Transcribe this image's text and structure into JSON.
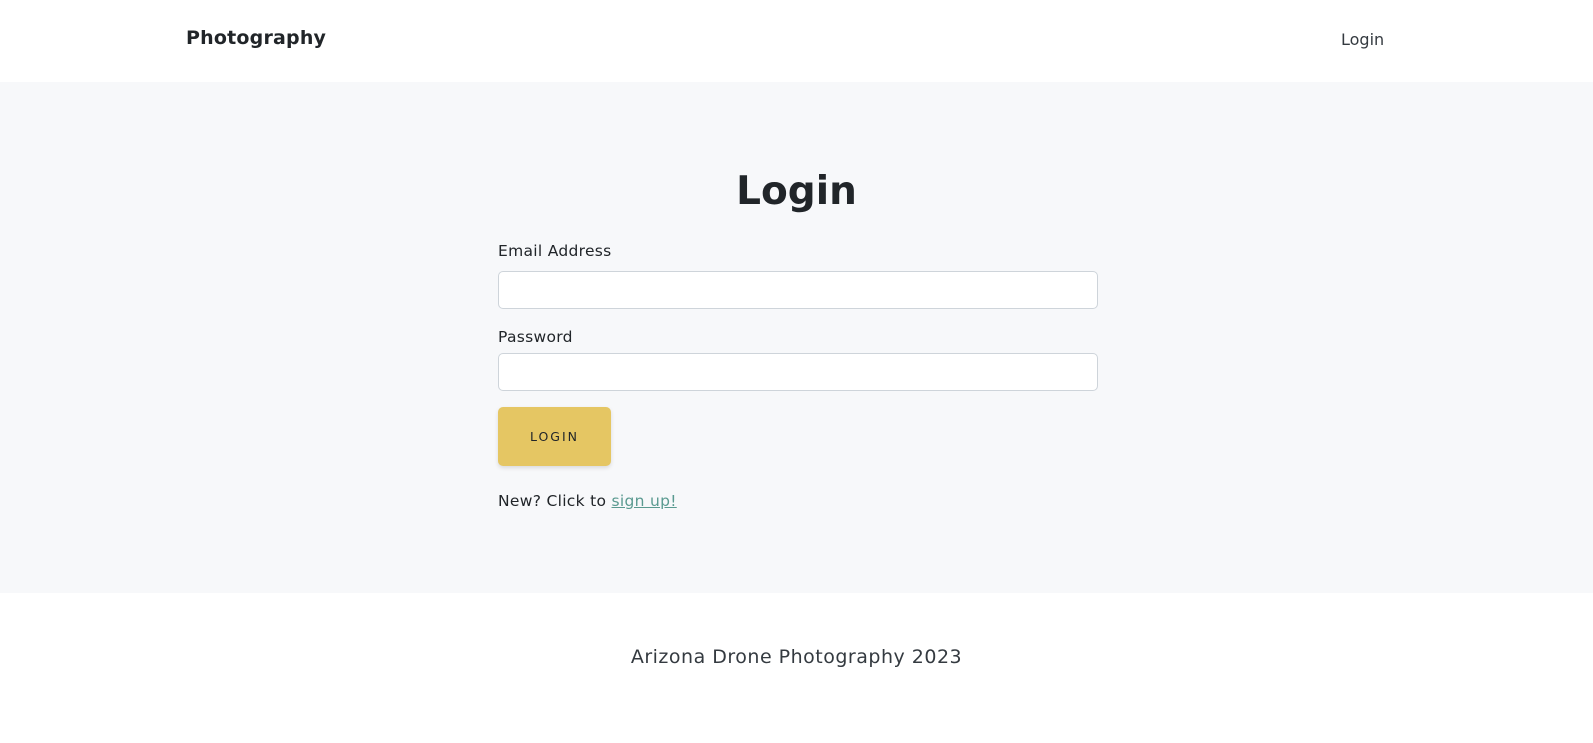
{
  "navbar": {
    "brand": "Photography",
    "links": [
      {
        "label": "Login"
      }
    ]
  },
  "main": {
    "title": "Login",
    "form": {
      "email": {
        "label": "Email Address",
        "value": "",
        "placeholder": ""
      },
      "password": {
        "label": "Password",
        "value": "",
        "placeholder": ""
      },
      "submit_label": "LOGIN"
    },
    "signup": {
      "prefix": "New? Click to ",
      "link_label": "sign up!"
    }
  },
  "footer": {
    "text": "Arizona Drone Photography 2023"
  },
  "colors": {
    "accent_button": "#e5c663",
    "link": "#5a9a90",
    "main_background": "#f7f8fa"
  }
}
